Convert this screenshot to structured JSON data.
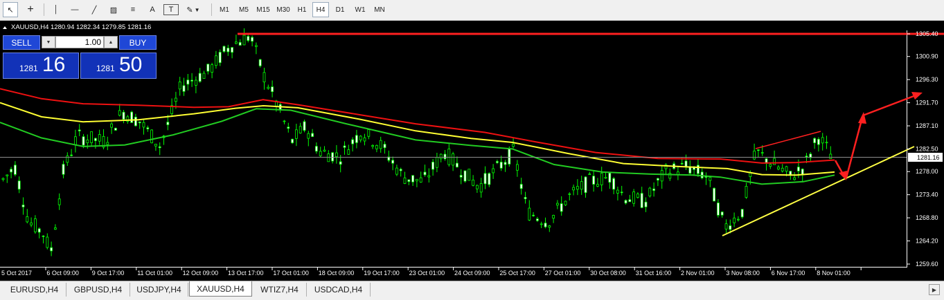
{
  "toolbar": {
    "tools": [
      {
        "name": "cursor-icon",
        "glyph": "↖"
      },
      {
        "name": "crosshair-icon",
        "glyph": "+"
      },
      {
        "name": "vertical-line-icon",
        "glyph": "│"
      },
      {
        "name": "horizontal-line-icon",
        "glyph": "—"
      },
      {
        "name": "trendline-icon",
        "glyph": "╱"
      },
      {
        "name": "equidistant-channel-icon",
        "glyph": "▨"
      },
      {
        "name": "fibonacci-icon",
        "glyph": "≡"
      },
      {
        "name": "text-icon",
        "glyph": "A"
      },
      {
        "name": "text-label-icon",
        "glyph": "T"
      },
      {
        "name": "shapes-icon",
        "glyph": "✎"
      }
    ],
    "timeframes": [
      "M1",
      "M5",
      "M15",
      "M30",
      "H1",
      "H4",
      "D1",
      "W1",
      "MN"
    ],
    "active_timeframe": "H4"
  },
  "chart": {
    "header": "XAUUSD,H4  1280.94 1282.34 1279.85 1281.16",
    "current_price_label": "1281.16",
    "price_axis": [
      "1305.40",
      "1300.90",
      "1296.30",
      "1291.70",
      "1287.10",
      "1282.50",
      "1278.00",
      "1273.40",
      "1268.80",
      "1264.20",
      "1259.60"
    ],
    "time_axis": [
      "5 Oct 2017",
      "6 Oct 09:00",
      "9 Oct 17:00",
      "11 Oct 01:00",
      "12 Oct 09:00",
      "13 Oct 17:00",
      "17 Oct 01:00",
      "18 Oct 09:00",
      "19 Oct 17:00",
      "23 Oct 01:00",
      "24 Oct 09:00",
      "25 Oct 17:00",
      "27 Oct 01:00",
      "30 Oct 08:00",
      "31 Oct 16:00",
      "2 Nov 01:00",
      "3 Nov 08:00",
      "6 Nov 17:00",
      "8 Nov 01:00"
    ],
    "colors": {
      "background": "#000000",
      "bull": "#00ff00",
      "bear": "#00ff00",
      "grid": "#ffffff",
      "ma_fast": "#22cc22",
      "ma_mid": "#ffff33",
      "ma_slow": "#ee1111",
      "annotation": "#ff2020",
      "support": "#ffff44"
    }
  },
  "trade_panel": {
    "sell_label": "SELL",
    "buy_label": "BUY",
    "lot": "1.00",
    "bid_prefix": "1281",
    "bid_suffix": "16",
    "ask_prefix": "1281",
    "ask_suffix": "50"
  },
  "tabs": [
    "EURUSD,H4",
    "GBPUSD,H4",
    "USDJPY,H4",
    "XAUUSD,H4",
    "WTIZ7,H4",
    "USDCAD,H4"
  ],
  "active_tab": "XAUUSD,H4"
}
